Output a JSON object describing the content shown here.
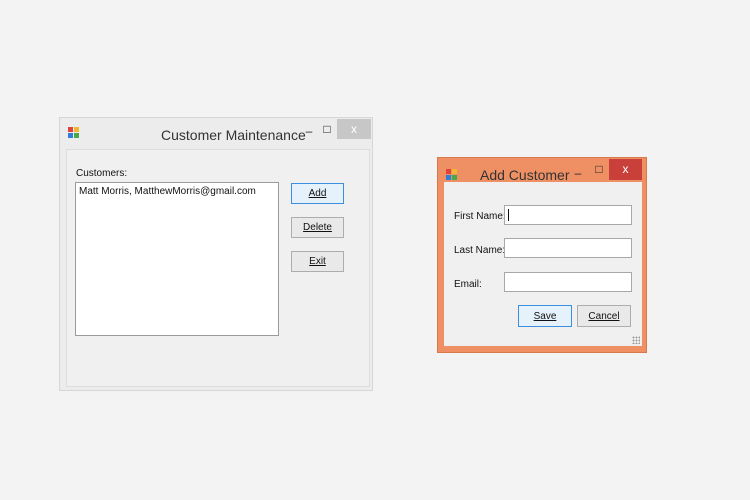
{
  "customer_maintenance": {
    "title": "Customer Maintenance",
    "minimize_glyph": "–",
    "maximize_glyph": "□",
    "close_glyph": "x",
    "customers_label": "Customers:",
    "customers": [
      "Matt Morris, MatthewMorris@gmail.com"
    ],
    "buttons": {
      "add": "Add",
      "delete": "Delete",
      "exit": "Exit"
    }
  },
  "add_customer": {
    "title": "Add Customer",
    "minimize_glyph": "–",
    "maximize_glyph": "□",
    "close_glyph": "x",
    "first_name_label": "First Name:",
    "last_name_label": "Last Name:",
    "email_label": "Email:",
    "first_name_value": "",
    "last_name_value": "",
    "email_value": "",
    "buttons": {
      "save": "Save",
      "cancel": "Cancel"
    }
  },
  "colors": {
    "active_frame": "#ee9064",
    "close_active": "#c9403a",
    "close_inactive": "#c7c7c7",
    "default_button_border": "#3c8fdc"
  }
}
